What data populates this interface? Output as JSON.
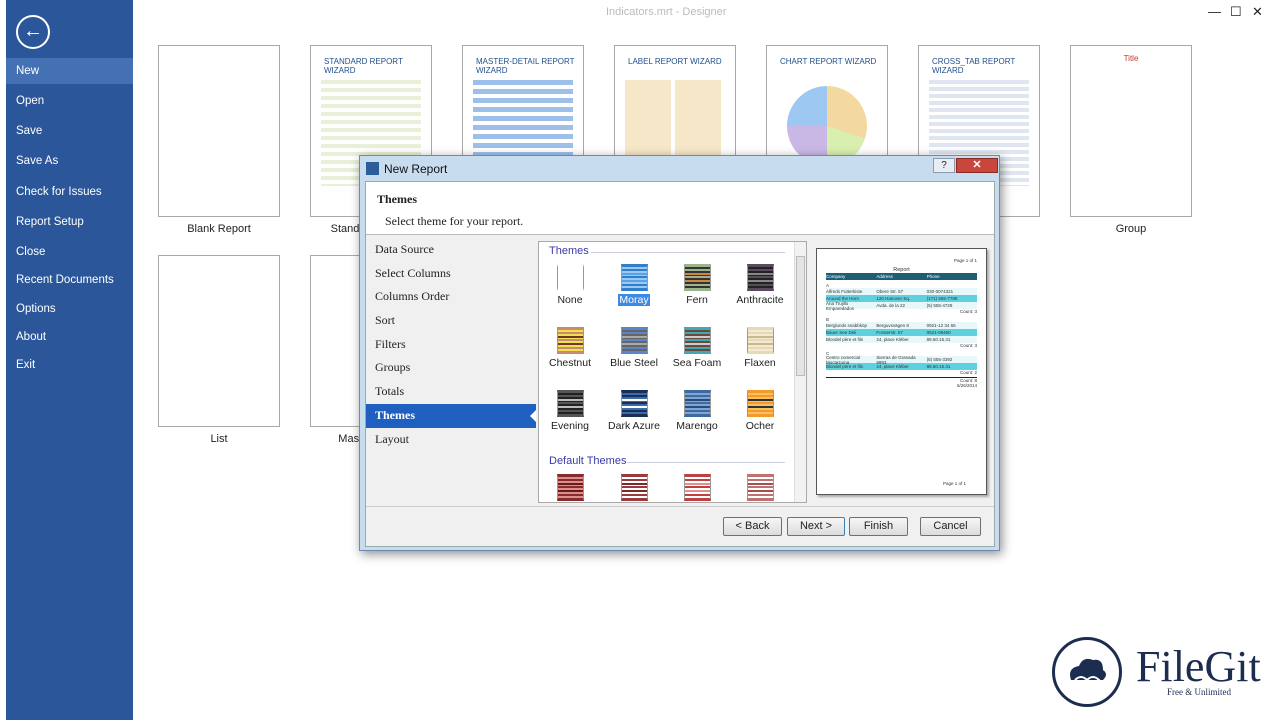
{
  "window": {
    "title": "Indicators.mrt - Designer",
    "minimize": "—",
    "maximize": "☐",
    "close": "✕"
  },
  "sidebar": {
    "back": "←",
    "items": [
      "New",
      "Open",
      "Save",
      "Save As",
      "Check for Issues",
      "Report Setup",
      "Close",
      "Recent Documents",
      "Options",
      "About",
      "Exit"
    ],
    "active": "New",
    "color": "#2b579a"
  },
  "templates": [
    {
      "thumb_title": "",
      "label": "Blank Report"
    },
    {
      "thumb_title": "STANDARD REPORT WIZARD",
      "label": "Standard Report"
    },
    {
      "thumb_title": "MASTER-DETAIL REPORT WIZARD",
      "label": ""
    },
    {
      "thumb_title": "LABEL REPORT WIZARD",
      "label": ""
    },
    {
      "thumb_title": "CHART REPORT WIZARD",
      "label": ""
    },
    {
      "thumb_title": "CROSS_TAB REPORT WIZARD",
      "label": ""
    },
    {
      "thumb_title": "Title",
      "label": "Group"
    },
    {
      "thumb_title": "",
      "label": "List"
    },
    {
      "thumb_title": "",
      "label": "Master-Detail"
    }
  ],
  "dialog": {
    "title": "New Report",
    "help": "?",
    "close": "✕",
    "header": {
      "title": "Themes",
      "subtitle": "Select theme for your report."
    },
    "steps": [
      "Data Source",
      "Select Columns",
      "Columns Order",
      "Sort",
      "Filters",
      "Groups",
      "Totals",
      "Themes",
      "Layout"
    ],
    "active_step": "Themes",
    "sections": {
      "themes": "Themes",
      "default": "Default Themes"
    },
    "themes": [
      {
        "name": "None",
        "colors": [
          "#ffffff",
          "#ffffff",
          "#ffffff"
        ]
      },
      {
        "name": "Moray",
        "colors": [
          "#2f7fcc",
          "#9cc8f2",
          "#5aa2e6"
        ],
        "selected": true
      },
      {
        "name": "Fern",
        "colors": [
          "#9bb58a",
          "#333333",
          "#d2853e"
        ]
      },
      {
        "name": "Anthracite",
        "colors": [
          "#5a4a5e",
          "#222222",
          "#888888"
        ]
      },
      {
        "name": "Chestnut",
        "colors": [
          "#c98a6e",
          "#f0e050",
          "#6b3a2a"
        ]
      },
      {
        "name": "Blue Steel",
        "colors": [
          "#5a86c8",
          "#666666",
          "#aaaaaa"
        ]
      },
      {
        "name": "Sea Foam",
        "colors": [
          "#3fa8b8",
          "#6b4a3a",
          "#cccccc"
        ]
      },
      {
        "name": "Flaxen",
        "colors": [
          "#e6d8b8",
          "#f3ead0",
          "#c9b88e"
        ]
      },
      {
        "name": "Evening",
        "colors": [
          "#555555",
          "#222222",
          "#bbbbbb"
        ]
      },
      {
        "name": "Dark Azure",
        "colors": [
          "#1a2f55",
          "#3a6aaa",
          "#ffffff"
        ]
      },
      {
        "name": "Marengo",
        "colors": [
          "#3e6aa0",
          "#7ea6d6",
          "#2a4a78"
        ]
      },
      {
        "name": "Ocher",
        "colors": [
          "#f39a2a",
          "#f8c060",
          "#333333"
        ]
      }
    ],
    "default_themes": [
      {
        "colors": [
          "#8a2a2a",
          "#d89090",
          "#6a1a1a"
        ]
      },
      {
        "colors": [
          "#9a3a3a",
          "#ffffff",
          "#7a2a2a"
        ]
      },
      {
        "colors": [
          "#c04040",
          "#ffffff",
          "#e09090"
        ]
      },
      {
        "colors": [
          "#c07070",
          "#ffffff",
          "#a05050"
        ]
      }
    ],
    "preview": {
      "page_top": "Page 1 of 1",
      "title": "Report",
      "headers": [
        "Company",
        "Address",
        "Phone"
      ],
      "groups": [
        {
          "key": "A",
          "rows": [
            [
              "Alfreds Futterkiste",
              "Obere Str. 57",
              "030-0074321"
            ],
            [
              "Around the Horn",
              "120 Hanover Sq.",
              "(171) 555-7788"
            ],
            [
              "Ana Trujillo Emparedados",
              "Avda. de la 22",
              "(5) 555-4729"
            ]
          ],
          "count": "Count: 3"
        },
        {
          "key": "B",
          "rows": [
            [
              "Berglunds snabbköp",
              "Berguvsvägen 8",
              "0921-12 34 65"
            ],
            [
              "Bauer See Deli",
              "Forsterstr. 57",
              "0621-08460"
            ],
            [
              "Blondel père et fils",
              "24, place Kléber",
              "88.60.15.31"
            ]
          ],
          "count": "Count: 3"
        },
        {
          "key": "C",
          "rows": [
            [
              "Centro comercial Moctezuma",
              "Sierras de Granada 9993",
              "(5) 555-3392"
            ],
            [
              "Blondel père et fils",
              "24, place Kléber",
              "88.60.15.31"
            ]
          ],
          "count": "Count: 2"
        }
      ],
      "total": "Count: 8",
      "date": "6/26/2014",
      "page_bottom": "Page 1 of 1",
      "header_color": "#1f5f73",
      "band_color": "#5fd0de"
    },
    "buttons": {
      "back": "< Back",
      "next": "Next >",
      "finish": "Finish",
      "cancel": "Cancel"
    }
  },
  "watermark": {
    "name": "FileGit",
    "tagline": "Free & Unlimited"
  }
}
